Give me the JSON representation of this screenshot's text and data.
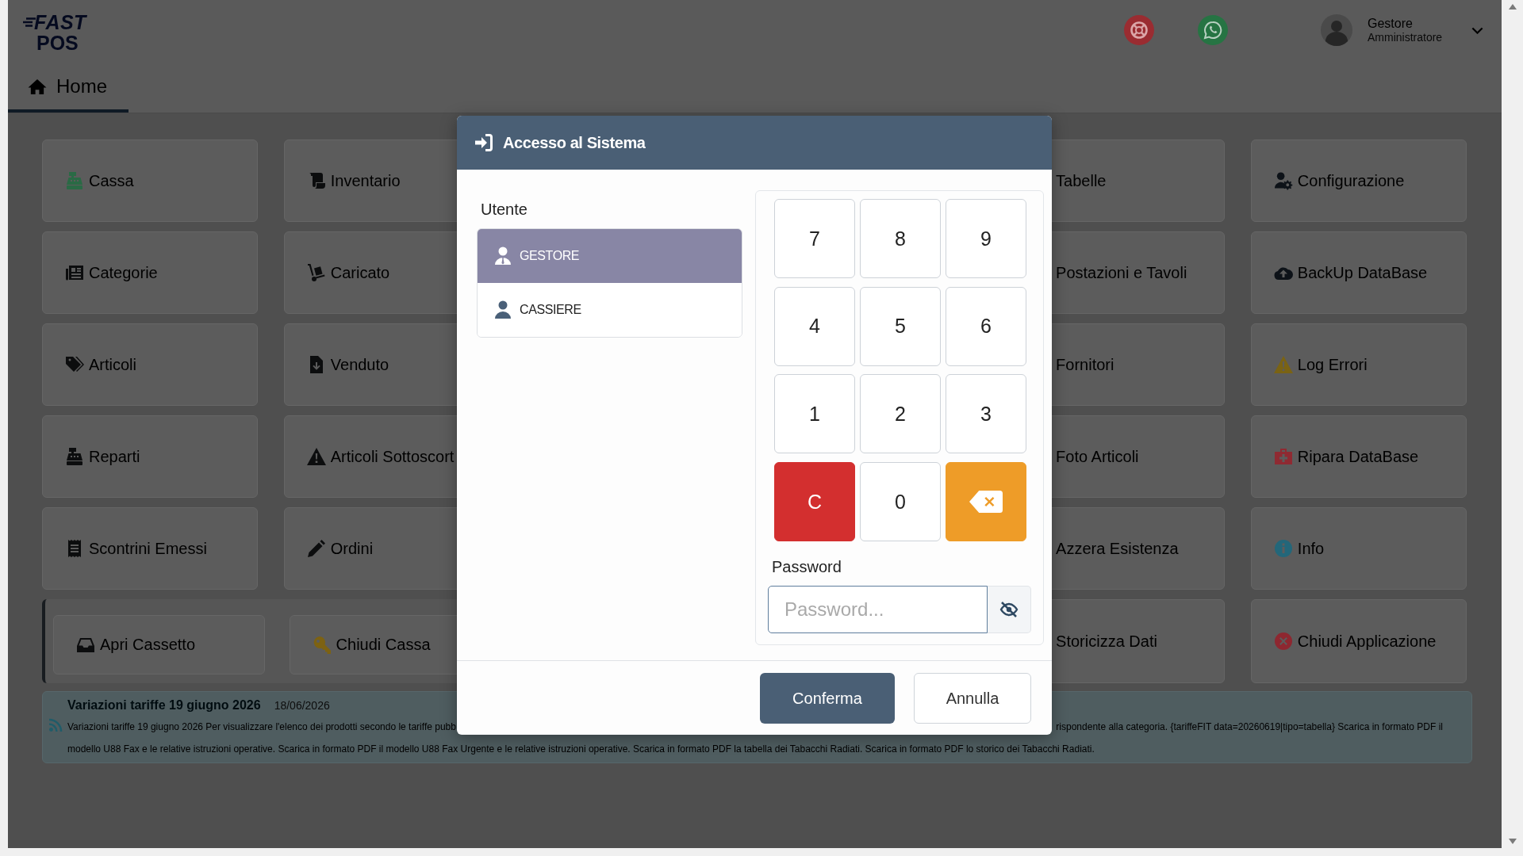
{
  "header": {
    "logo": {
      "top": "FAST",
      "bottom": "POS"
    },
    "user": {
      "name": "Gestore",
      "role": "Amministratore"
    }
  },
  "tabs": [
    {
      "label": "Home",
      "selected": true
    }
  ],
  "menu_rows": [
    {
      "kind": "plain",
      "left": [
        {
          "label": "Cassa",
          "kind": "cash-register",
          "color": "#2a6a45"
        },
        {
          "label": "Inventario",
          "kind": "scroll",
          "color": "#0c0d0e"
        }
      ],
      "right": [
        {
          "label": "Tabelle"
        },
        {
          "label": "Configurazione",
          "kind": "user-gear",
          "color": "#0d1218"
        }
      ]
    },
    {
      "kind": "plain",
      "left": [
        {
          "label": "Categorie",
          "kind": "newspaper",
          "color": "#0c0d0e"
        },
        {
          "label": "Caricato",
          "kind": "hand-truck",
          "color": "#0c0d0e"
        }
      ],
      "right": [
        {
          "label": "Postazioni e Tavoli"
        },
        {
          "label": "BackUp DataBase",
          "kind": "cloud-upload",
          "color": "#0d1218"
        }
      ]
    },
    {
      "kind": "plain",
      "left": [
        {
          "label": "Articoli",
          "kind": "tags",
          "color": "#0c0d0e"
        },
        {
          "label": "Venduto",
          "kind": "file-download",
          "color": "#0c0d0e"
        }
      ],
      "right": [
        {
          "label": "Fornitori"
        },
        {
          "label": "Log Errori",
          "kind": "warning",
          "color": "#7a6314"
        }
      ]
    },
    {
      "kind": "plain",
      "left": [
        {
          "label": "Reparti",
          "kind": "cash-register",
          "color": "#0c0d0e"
        },
        {
          "label": "Articoli Sottoscort",
          "kind": "warning",
          "color": "#0c0d0e"
        }
      ],
      "right": [
        {
          "label": "Foto Articoli"
        },
        {
          "label": "Ripara DataBase",
          "kind": "first-aid",
          "color": "#8f2a32"
        }
      ]
    },
    {
      "kind": "plain",
      "left": [
        {
          "label": "Scontrini Emessi",
          "kind": "receipt",
          "color": "#0c0d0e"
        },
        {
          "label": "Ordini",
          "kind": "pen",
          "color": "#0c0d0e"
        }
      ],
      "right": [
        {
          "label": "Azzera Esistenza"
        },
        {
          "label": "Info",
          "kind": "info",
          "color": "#23677a"
        }
      ]
    },
    {
      "kind": "panel",
      "left": [
        {
          "label": "Apri Cassetto",
          "kind": "tray",
          "color": "#0c0d0e"
        },
        {
          "label": "Chiudi Cassa",
          "kind": "key",
          "color": "#7d6212"
        }
      ],
      "right": [
        {
          "label": "Storicizza Dati"
        },
        {
          "label": "Chiudi Applicazione",
          "kind": "close-circle",
          "color": "#8e2730"
        }
      ]
    }
  ],
  "news": {
    "title": "Variazioni tariffe 19 giugno 2026",
    "date": "18/06/2026",
    "lines": [
      {
        "parts": [
          "Variazioni tariffe 19 giugno 2026 Per visualizzare l'elenco dei prodotti secondo le tariffe pubb",
          "rispondente alla categoria. {tariffeFIT data=20260619|tipo=tabella} Scarica in formato PDF il"
        ]
      },
      {
        "parts": [
          "modello U88 Fax e le relative istruzioni operative. Scarica in formato PDF il modello U88 Fax Urgente e le relative istruzioni operative. Scarica in formato PDF la tabella dei Tabacchi Radiati. Scarica in formato PDF lo storico dei Tabacchi Radiati."
        ]
      }
    ]
  },
  "dialog": {
    "title": "Accesso al Sistema",
    "users_label": "Utente",
    "users": [
      {
        "name": "GESTORE",
        "kind": "manager",
        "selected": true
      },
      {
        "name": "CASSIERE",
        "kind": "user",
        "selected": false
      }
    ],
    "keys": [
      {
        "label": "7",
        "kind": "digit"
      },
      {
        "label": "8",
        "kind": "digit"
      },
      {
        "label": "9",
        "kind": "digit"
      },
      {
        "label": "4",
        "kind": "digit"
      },
      {
        "label": "5",
        "kind": "digit"
      },
      {
        "label": "6",
        "kind": "digit"
      },
      {
        "label": "1",
        "kind": "digit"
      },
      {
        "label": "2",
        "kind": "digit"
      },
      {
        "label": "3",
        "kind": "digit"
      },
      {
        "label": "C",
        "kind": "clear"
      },
      {
        "label": "0",
        "kind": "digit"
      },
      {
        "kind": "backspace"
      }
    ],
    "password": {
      "label": "Password",
      "placeholder": "Password..."
    },
    "buttons": [
      {
        "label": "Conferma",
        "kind": "primary"
      },
      {
        "label": "Annulla",
        "kind": "secondary"
      }
    ]
  }
}
